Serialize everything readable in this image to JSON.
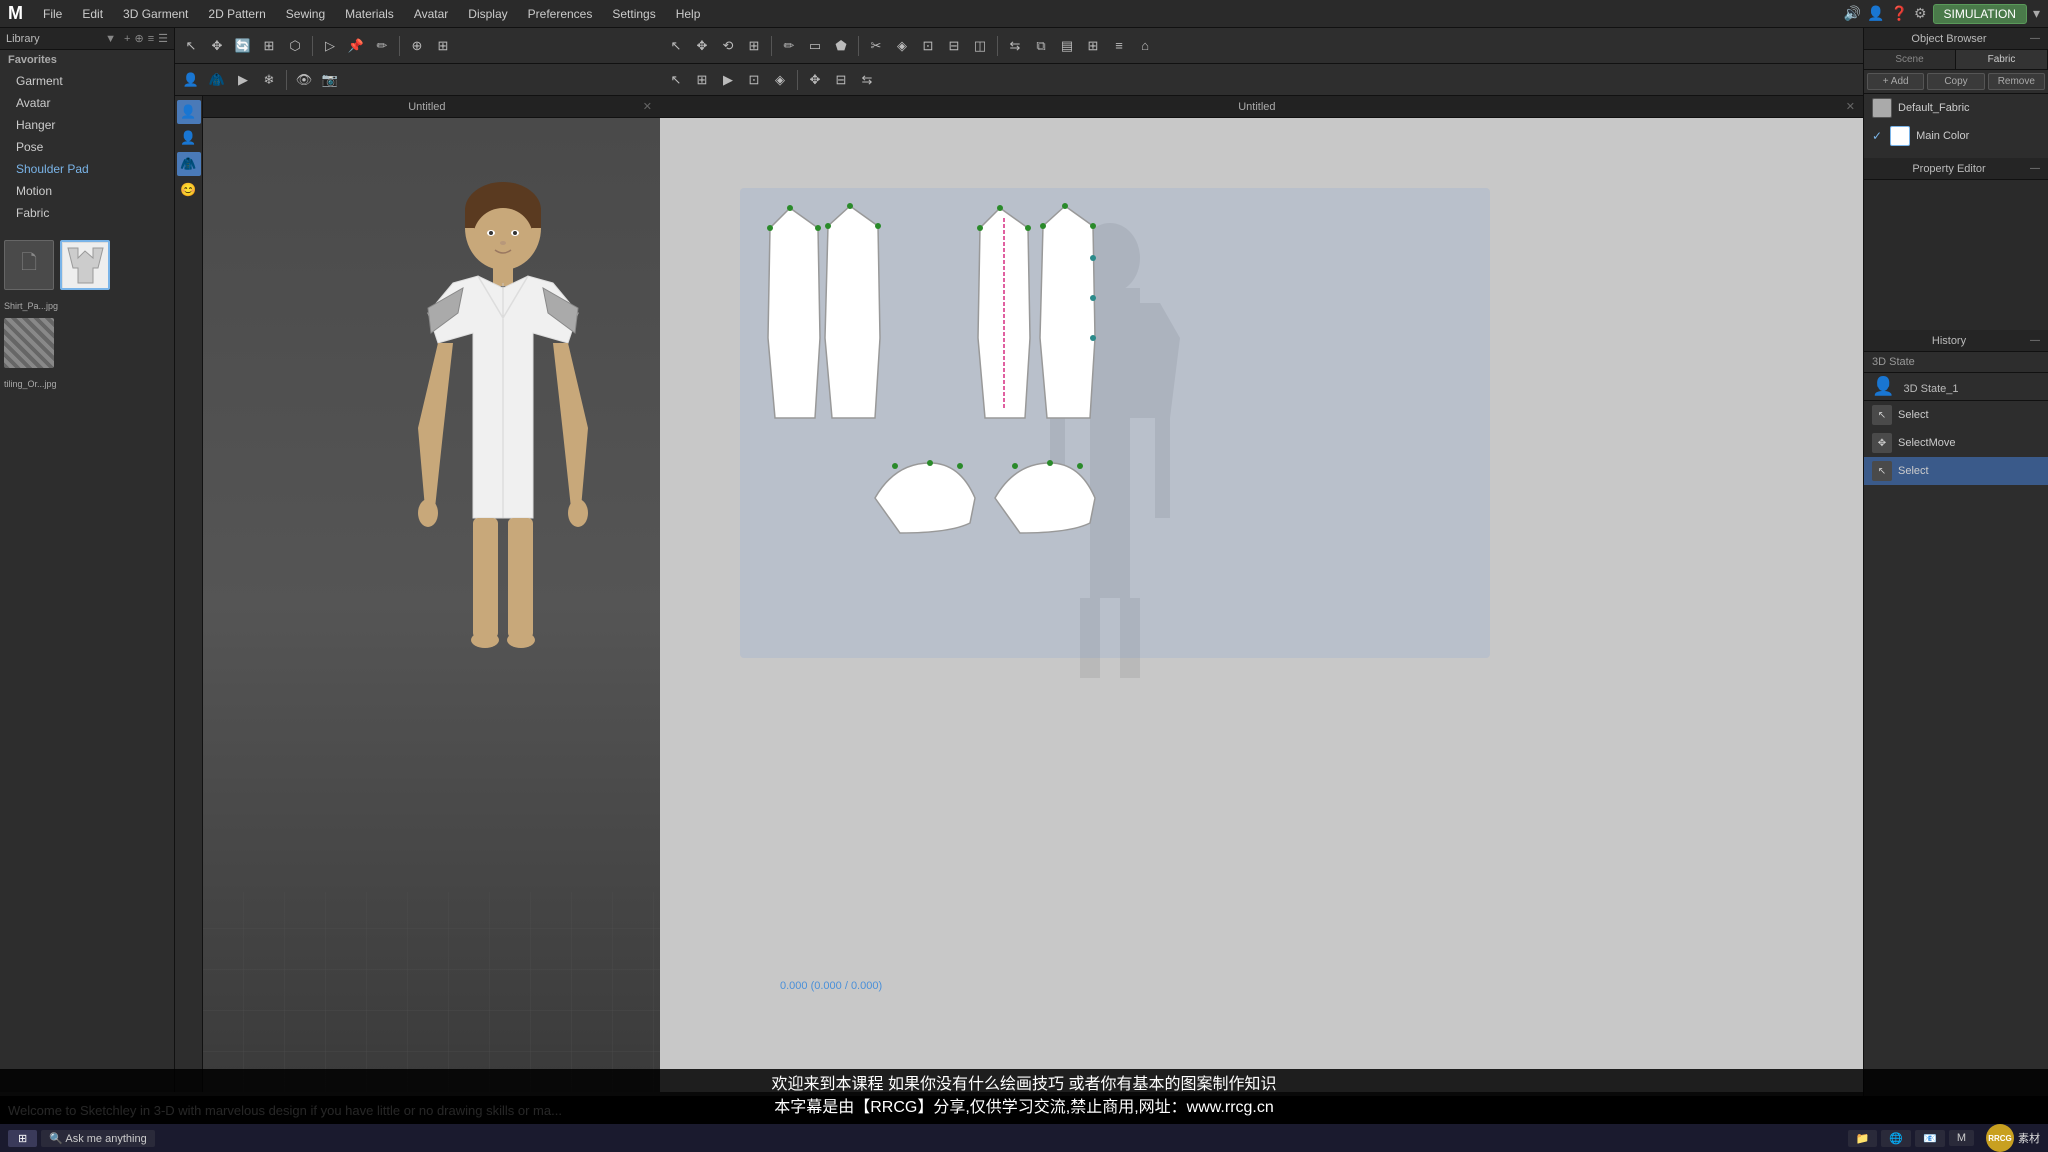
{
  "app": {
    "logo": "M",
    "simulation_label": "SIMULATION",
    "title_3d": "Untitled",
    "title_2d": "Untitled"
  },
  "menubar": {
    "items": [
      "File",
      "Edit",
      "3D Garment",
      "2D Pattern",
      "Sewing",
      "Materials",
      "Avatar",
      "Display",
      "Preferences",
      "Settings",
      "Help"
    ]
  },
  "library": {
    "title": "Library",
    "dropdown_arrow": "▼"
  },
  "nav_items": [
    {
      "id": "favorites",
      "label": "Favorites"
    },
    {
      "id": "garment",
      "label": "Garment"
    },
    {
      "id": "avatar",
      "label": "Avatar"
    },
    {
      "id": "hanger",
      "label": "Hanger"
    },
    {
      "id": "pose",
      "label": "Pose"
    },
    {
      "id": "shoulder_pad",
      "label": "Shoulder Pad"
    },
    {
      "id": "motion",
      "label": "Motion"
    },
    {
      "id": "fabric",
      "label": "Fabric"
    }
  ],
  "thumbnails": [
    {
      "id": "thumb1",
      "label": "..."
    },
    {
      "id": "thumb2",
      "label": "Shirt_Pa...jpg"
    },
    {
      "id": "thumb3",
      "label": "tiling_Or...jpg"
    }
  ],
  "object_browser": {
    "title": "Object Browser",
    "tabs": [
      "Scene",
      "Fabric"
    ],
    "active_tab": "Fabric",
    "add_label": "+ Add",
    "copy_label": "Copy",
    "remove_label": "Remove",
    "items": [
      {
        "id": "default_fabric",
        "label": "Default_Fabric",
        "active": false
      },
      {
        "id": "main_color",
        "label": "Main Color",
        "active": true
      }
    ]
  },
  "property_editor": {
    "title": "Property Editor"
  },
  "history": {
    "title": "History",
    "section_label": "3D State",
    "state_label": "3D State_1",
    "items": [
      {
        "id": "state1",
        "label": "3D State_1",
        "active": false
      },
      {
        "id": "select1",
        "label": "Select",
        "active": false
      },
      {
        "id": "select_move",
        "label": "SelectMove",
        "active": false
      },
      {
        "id": "select2",
        "label": "Select",
        "active": true
      }
    ]
  },
  "coords": {
    "display": "0.000 (0.000 / 0.000)"
  },
  "subtitles": {
    "cn_line1": "欢迎来到本课程 如果你没有什么绘画技巧 或者你有基本的图案制作知识",
    "cn_line2": "本字幕是由【RRCG】分享,仅供学习交流,禁止商用,网址：www.rrcg.cn",
    "en_line": "Welcome to Sketchley in 3-D with marvelous design if you have little or no drawing skills or ma..."
  },
  "watermark": {
    "circle_text": "RRCG",
    "text": "素材"
  },
  "icons": {
    "person": "👤",
    "gear": "⚙",
    "help": "?",
    "speaker": "🔊",
    "search": "🔍",
    "arrow_down": "▾",
    "arrow_right": "▸",
    "close": "✕",
    "checkmark": "✓",
    "minimize": "—",
    "maximize": "□"
  }
}
